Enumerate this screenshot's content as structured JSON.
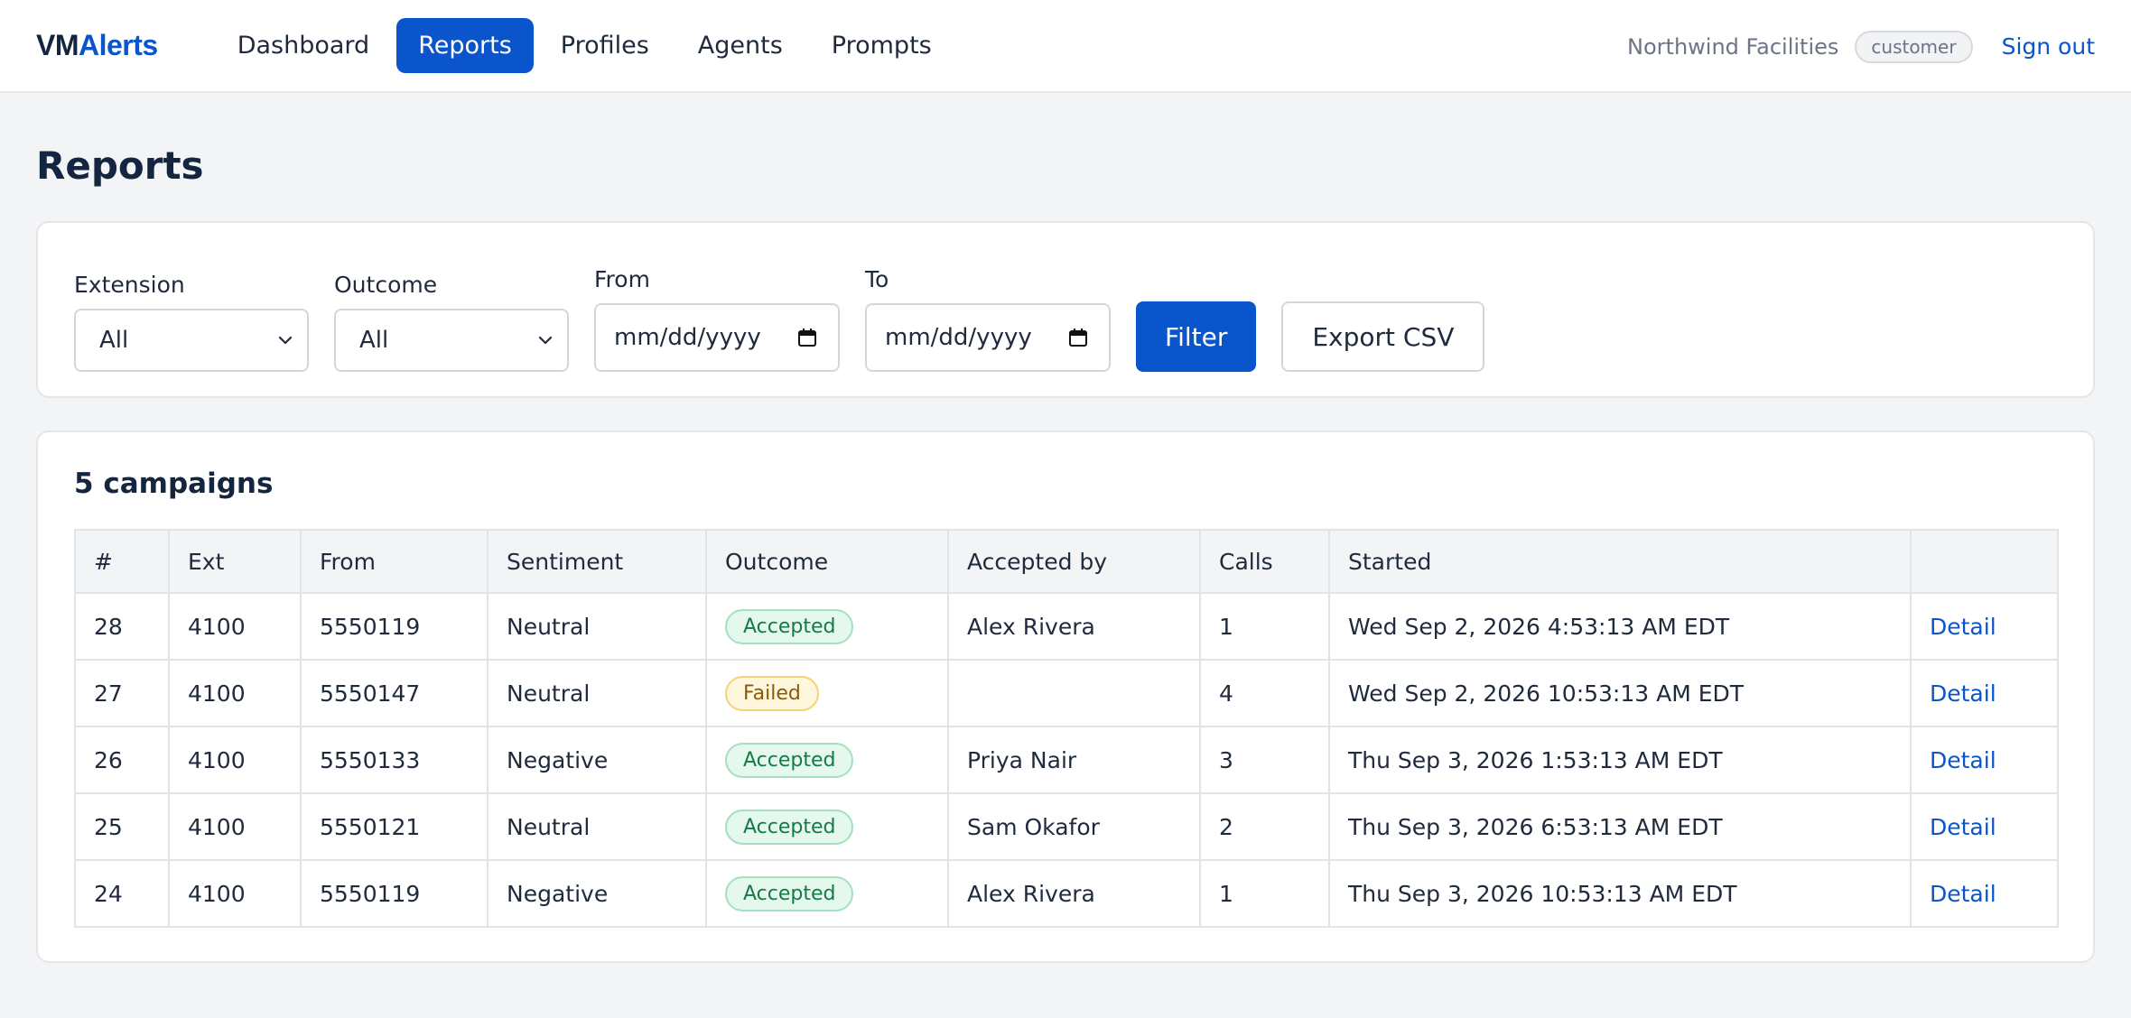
{
  "app": {
    "brand_part1": "VM",
    "brand_part2": "Alerts"
  },
  "nav": {
    "items": [
      {
        "label": "Dashboard",
        "active": false
      },
      {
        "label": "Reports",
        "active": true
      },
      {
        "label": "Profiles",
        "active": false
      },
      {
        "label": "Agents",
        "active": false
      },
      {
        "label": "Prompts",
        "active": false
      }
    ]
  },
  "account": {
    "org": "Northwind Facilities",
    "role": "customer",
    "signout_label": "Sign out"
  },
  "page": {
    "title": "Reports"
  },
  "filters": {
    "extension_label": "Extension",
    "extension_value": "All",
    "outcome_label": "Outcome",
    "outcome_value": "All",
    "from_label": "From",
    "from_placeholder": "mm/dd/yyyy",
    "to_label": "To",
    "to_placeholder": "mm/dd/yyyy",
    "filter_button": "Filter",
    "export_button": "Export CSV"
  },
  "results": {
    "summary": "5 campaigns",
    "columns": [
      "#",
      "Ext",
      "From",
      "Sentiment",
      "Outcome",
      "Accepted by",
      "Calls",
      "Started",
      ""
    ],
    "rows": [
      {
        "id": "28",
        "ext": "4100",
        "from": "5550119",
        "sentiment": "Neutral",
        "outcome": "Accepted",
        "accepted_by": "Alex Rivera",
        "calls": "1",
        "started": "Wed Sep 2, 2026 4:53:13 AM EDT",
        "action": "Detail"
      },
      {
        "id": "27",
        "ext": "4100",
        "from": "5550147",
        "sentiment": "Neutral",
        "outcome": "Failed",
        "accepted_by": "",
        "calls": "4",
        "started": "Wed Sep 2, 2026 10:53:13 AM EDT",
        "action": "Detail"
      },
      {
        "id": "26",
        "ext": "4100",
        "from": "5550133",
        "sentiment": "Negative",
        "outcome": "Accepted",
        "accepted_by": "Priya Nair",
        "calls": "3",
        "started": "Thu Sep 3, 2026 1:53:13 AM EDT",
        "action": "Detail"
      },
      {
        "id": "25",
        "ext": "4100",
        "from": "5550121",
        "sentiment": "Neutral",
        "outcome": "Accepted",
        "accepted_by": "Sam Okafor",
        "calls": "2",
        "started": "Thu Sep 3, 2026 6:53:13 AM EDT",
        "action": "Detail"
      },
      {
        "id": "24",
        "ext": "4100",
        "from": "5550119",
        "sentiment": "Negative",
        "outcome": "Accepted",
        "accepted_by": "Alex Rivera",
        "calls": "1",
        "started": "Thu Sep 3, 2026 10:53:13 AM EDT",
        "action": "Detail"
      }
    ]
  },
  "colors": {
    "accent": "#0a55cc",
    "brand_dark": "#14263f",
    "accepted_bg": "#e5f8ee",
    "accepted_text": "#157a45",
    "failed_bg": "#fef6dd",
    "failed_text": "#8a5a08"
  },
  "icons": {
    "select_caret": "chevron-down-icon",
    "date_picker": "calendar-icon"
  }
}
